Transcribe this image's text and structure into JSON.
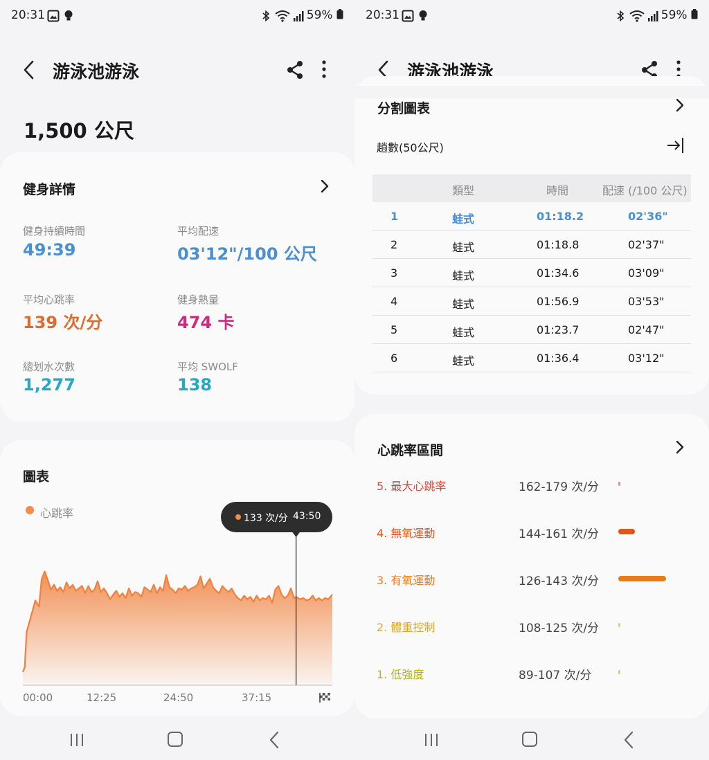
{
  "status": {
    "time": "20:31",
    "battery": "59%"
  },
  "app": {
    "title": "游泳池游泳"
  },
  "summary": {
    "distance": "1,500 公尺"
  },
  "workout": {
    "title": "健身詳情",
    "duration": {
      "label": "健身持續時間",
      "value": "49:39",
      "color": "#4a90d0"
    },
    "pace": {
      "label": "平均配速",
      "value": "03'12\"/100 公尺",
      "color": "#4a90d0"
    },
    "heart": {
      "label": "平均心跳率",
      "value": "139 次/分",
      "color": "#e06c2c"
    },
    "calories": {
      "label": "健身熱量",
      "value": "474 卡",
      "color": "#d02a7e"
    },
    "strokes": {
      "label": "總划水次數",
      "value": "1,277",
      "color": "#25a8c4"
    },
    "swolf": {
      "label": "平均 SWOLF",
      "value": "138",
      "color": "#25a8c4"
    }
  },
  "chart_section": {
    "title": "圖表",
    "legend": "心跳率",
    "tooltip": {
      "value": "133 次/分",
      "time": "43:50"
    }
  },
  "chart_data": {
    "type": "area",
    "series": [
      {
        "name": "心跳率",
        "color": "#f28b4c"
      }
    ],
    "x_ticks": [
      "00:00",
      "12:25",
      "24:50",
      "37:15"
    ],
    "x_range_minutes": [
      0,
      49.65
    ],
    "y_range": [
      60,
      180
    ],
    "x": [
      0,
      0.3,
      0.6,
      1.2,
      2,
      2.6,
      3,
      3.5,
      4,
      4.5,
      5,
      5.5,
      6,
      6.5,
      7,
      7.5,
      8,
      8.5,
      9,
      9.5,
      10,
      10.5,
      11,
      11.5,
      12,
      12.5,
      13,
      13.5,
      14,
      14.5,
      15,
      15.5,
      16,
      16.5,
      17,
      17.5,
      18,
      18.5,
      19,
      19.5,
      20,
      20.5,
      21,
      21.5,
      22,
      22.5,
      23,
      23.5,
      24,
      24.5,
      25,
      25.5,
      26,
      26.5,
      27,
      27.5,
      28,
      28.5,
      29,
      29.5,
      30,
      30.5,
      31,
      31.5,
      32,
      32.5,
      33,
      33.5,
      34,
      34.5,
      35,
      35.5,
      36,
      36.5,
      37,
      37.5,
      38,
      38.5,
      39,
      39.5,
      40,
      40.5,
      41,
      41.5,
      42,
      42.5,
      43,
      43.5,
      43.83,
      44.5,
      45,
      45.5,
      46,
      46.5,
      47,
      47.5,
      48,
      48.5,
      49,
      49.65
    ],
    "values": [
      71,
      75,
      104,
      115,
      130,
      125,
      147,
      154,
      147,
      139,
      143,
      138,
      141,
      137,
      145,
      140,
      143,
      138,
      140,
      142,
      136,
      142,
      137,
      139,
      146,
      137,
      140,
      136,
      131,
      135,
      138,
      133,
      136,
      132,
      140,
      134,
      137,
      136,
      133,
      141,
      139,
      137,
      143,
      136,
      141,
      138,
      151,
      141,
      139,
      136,
      140,
      139,
      142,
      138,
      140,
      141,
      143,
      150,
      140,
      144,
      148,
      141,
      138,
      136,
      142,
      139,
      137,
      140,
      135,
      132,
      130,
      134,
      131,
      133,
      129,
      134,
      130,
      132,
      131,
      134,
      128,
      139,
      142,
      135,
      132,
      134,
      140,
      132,
      133,
      131,
      132,
      130,
      131,
      134,
      130,
      132,
      130,
      132,
      131,
      135
    ]
  },
  "splits": {
    "title": "分割圖表",
    "lap_label": "趟數(50公尺)",
    "headers": [
      "類型",
      "時間",
      "配速 (/100 公尺)"
    ],
    "rows": [
      [
        "1",
        "蛙式",
        "01:18.2",
        "02'36\""
      ],
      [
        "2",
        "蛙式",
        "01:18.8",
        "02'37\""
      ],
      [
        "3",
        "蛙式",
        "01:34.6",
        "03'09\""
      ],
      [
        "4",
        "蛙式",
        "01:56.9",
        "03'53\""
      ],
      [
        "5",
        "蛙式",
        "01:23.7",
        "02'47\""
      ],
      [
        "6",
        "蛙式",
        "01:36.4",
        "03'12\""
      ]
    ]
  },
  "hr_zones": {
    "title": "心跳率區間",
    "zones": [
      {
        "name": "5. 最大心跳率",
        "range": "162-179 次/分",
        "color": "#d9483a",
        "fraction": 0.01
      },
      {
        "name": "4. 無氧運動",
        "range": "144-161 次/分",
        "color": "#e2541c",
        "fraction": 0.28
      },
      {
        "name": "3. 有氧運動",
        "range": "126-143 次/分",
        "color": "#ec7a16",
        "fraction": 0.82
      },
      {
        "name": "2. 體重控制",
        "range": "108-125 次/分",
        "color": "#d9a91c",
        "fraction": 0.01
      },
      {
        "name": "1. 低強度",
        "range": "89-107 次/分",
        "color": "#b7b319",
        "fraction": 0.01
      }
    ]
  }
}
